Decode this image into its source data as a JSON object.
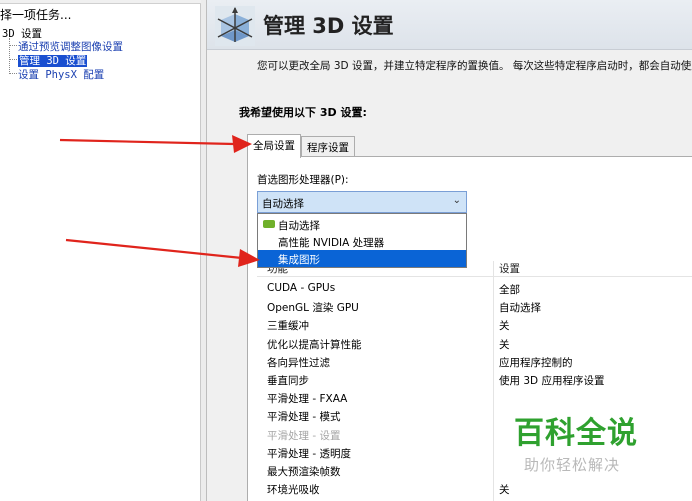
{
  "left_pane": {
    "task_title": "择一项任务...",
    "tree": {
      "root": "3D 设置",
      "items": [
        {
          "label": "通过预览调整图像设置",
          "selected": false
        },
        {
          "label": "管理 3D 设置",
          "selected": true
        },
        {
          "label": "设置 PhysX 配置",
          "selected": false
        }
      ]
    }
  },
  "header": {
    "title": "管理 3D 设置",
    "description": "您可以更改全局 3D 设置，并建立特定程序的置换值。 每次这些特定程序启动时，都会自动使用"
  },
  "section_heading": "我希望使用以下 3D 设置:",
  "tabs": [
    {
      "label": "全局设置",
      "active": true
    },
    {
      "label": "程序设置",
      "active": false
    }
  ],
  "gpu": {
    "label": "首选图形处理器(P):",
    "selected": "自动选择",
    "options": [
      {
        "label": "自动选择",
        "icon": "nvidia-icon",
        "highlighted": false
      },
      {
        "label": "高性能 NVIDIA 处理器",
        "highlighted": false
      },
      {
        "label": "集成图形",
        "highlighted": true
      }
    ]
  },
  "settings_table": {
    "headers": [
      "功能",
      "设置"
    ],
    "rows": [
      {
        "feature": "CUDA - GPUs",
        "setting": "全部",
        "disabled": false
      },
      {
        "feature": "OpenGL 渲染 GPU",
        "setting": "自动选择",
        "disabled": false
      },
      {
        "feature": "三重缓冲",
        "setting": "关",
        "disabled": false
      },
      {
        "feature": "优化以提高计算性能",
        "setting": "关",
        "disabled": false
      },
      {
        "feature": "各向异性过滤",
        "setting": "应用程序控制的",
        "disabled": false
      },
      {
        "feature": "垂直同步",
        "setting": "使用 3D 应用程序设置",
        "disabled": false
      },
      {
        "feature": "平滑处理 - FXAA",
        "setting": "",
        "disabled": false
      },
      {
        "feature": "平滑处理 - 模式",
        "setting": "",
        "disabled": false
      },
      {
        "feature": "平滑处理 - 设置",
        "setting": "",
        "disabled": true
      },
      {
        "feature": "平滑处理 - 透明度",
        "setting": "",
        "disabled": false
      },
      {
        "feature": "最大预渲染帧数",
        "setting": "",
        "disabled": false
      },
      {
        "feature": "环境光吸收",
        "setting": "关",
        "disabled": false
      }
    ]
  },
  "watermark": {
    "title": "百科全说",
    "subtitle": "助你轻松解决"
  },
  "colors": {
    "selection_blue": "#0a64d6",
    "tree_link": "#1a3fb0",
    "annotation_red": "#e0241c",
    "watermark_green": "#2fa12f",
    "combo_fill": "#cfe3f7"
  }
}
